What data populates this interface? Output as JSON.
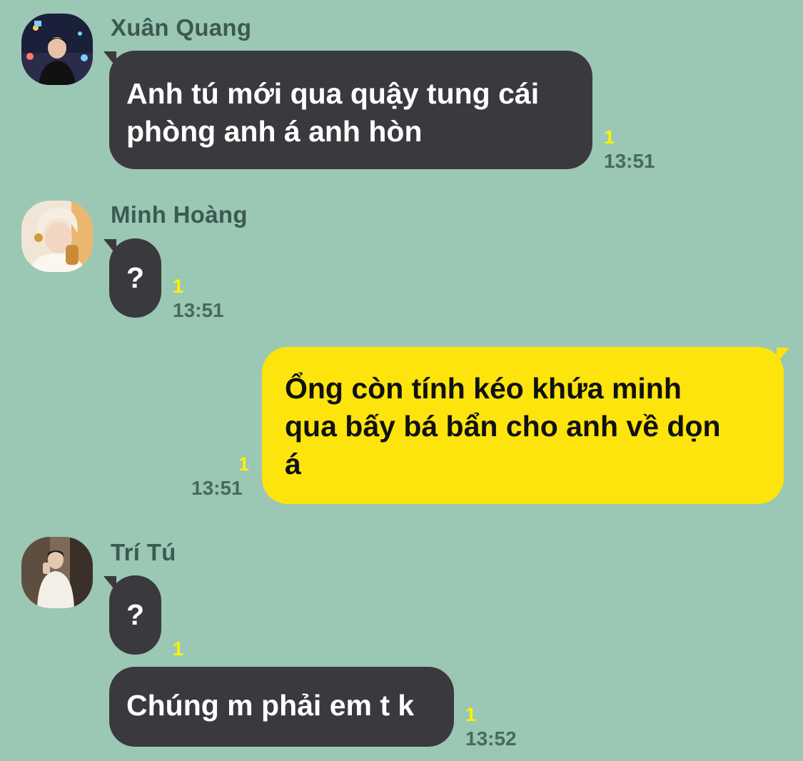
{
  "colors": {
    "background": "#9bc7b5",
    "incoming_bubble": "#3a393e",
    "outgoing_bubble": "#fde40c",
    "unread_count": "#fff200",
    "timestamp": "#486a5e"
  },
  "messages": [
    {
      "sender": "Xuân Quang",
      "avatar_icon": "profile-photo-icon",
      "text_lines": [
        "Anh tú mới qua quậy tung cái",
        "phòng anh á anh hòn"
      ],
      "unread": "1",
      "time": "13:51"
    },
    {
      "sender": "Minh Hoàng",
      "avatar_icon": "profile-photo-icon",
      "text": "?",
      "unread": "1",
      "time": "13:51"
    },
    {
      "sender": "",
      "outgoing": true,
      "text_lines": [
        "Ổng còn tính kéo khứa minh",
        "qua bấy bá bẩn cho anh về dọn",
        "á"
      ],
      "unread": "1",
      "time": "13:51"
    },
    {
      "sender": "Trí Tú",
      "avatar_icon": "profile-photo-icon",
      "text": "?",
      "unread": "1",
      "time": ""
    },
    {
      "sender": "",
      "text": "Chúng m phải em t k",
      "unread": "1",
      "time": "13:52"
    }
  ]
}
